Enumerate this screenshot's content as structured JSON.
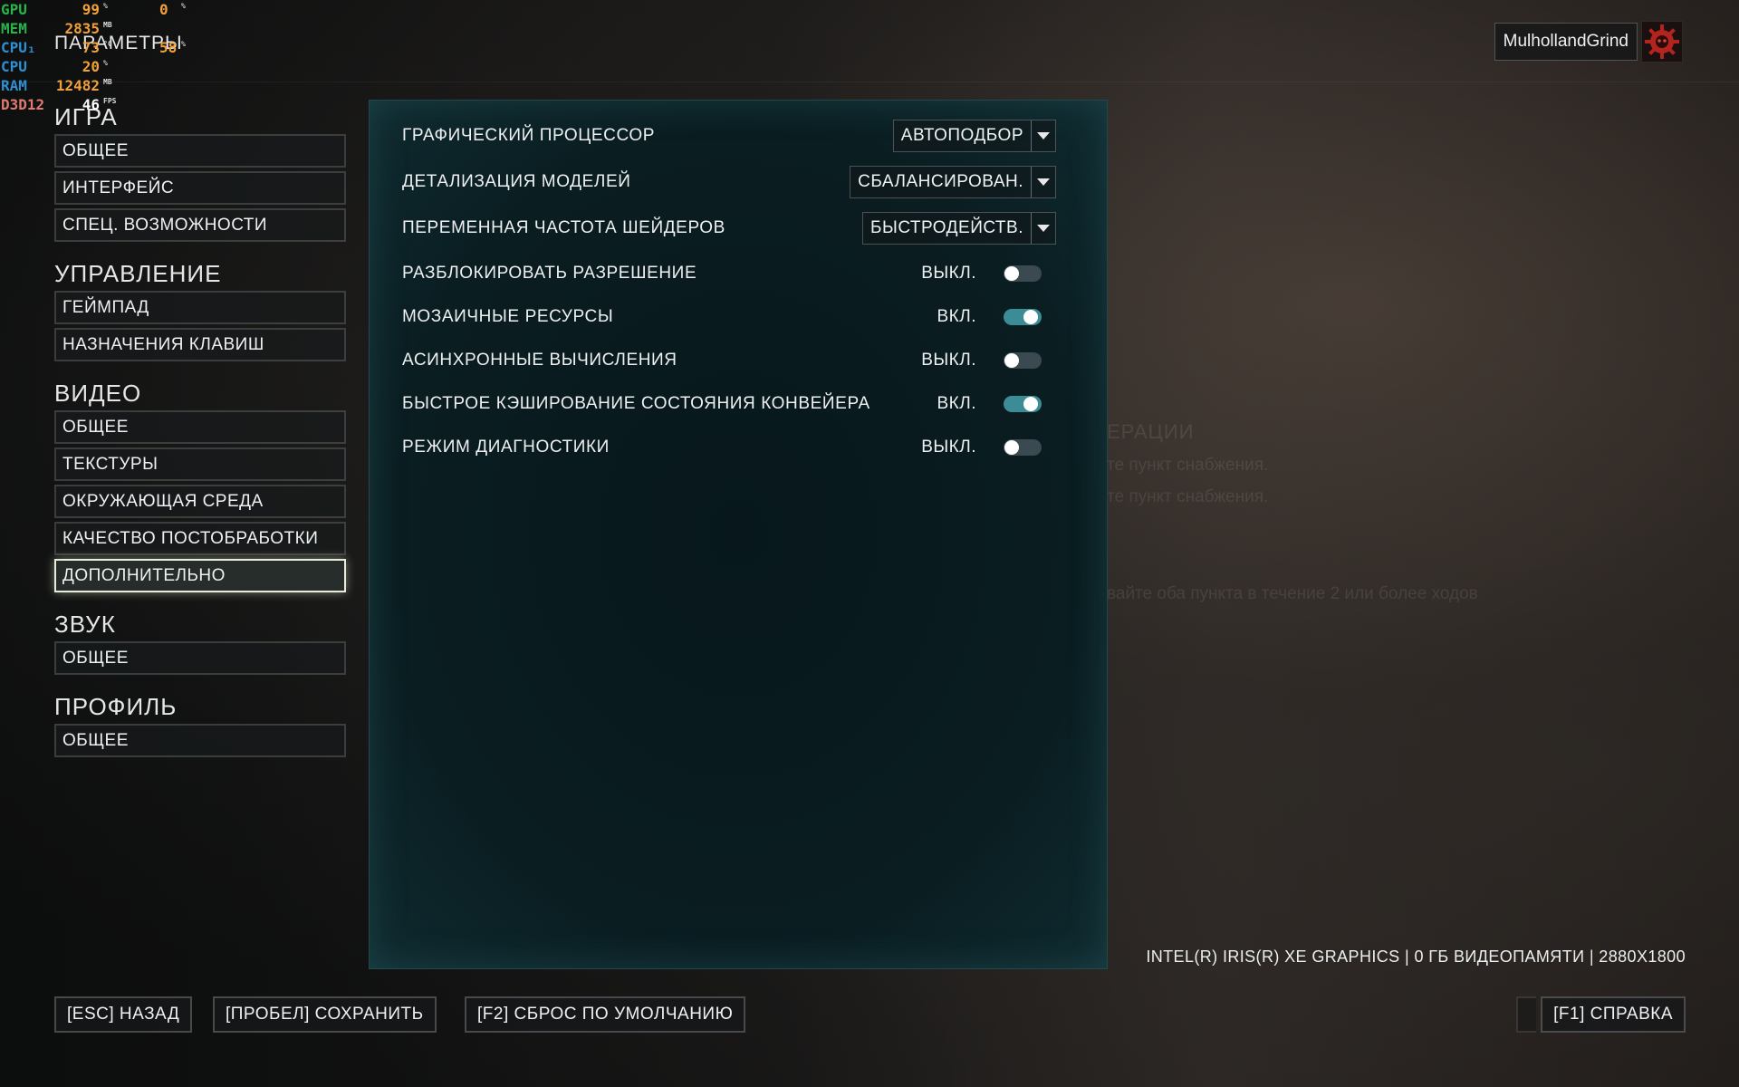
{
  "perf_overlay": {
    "rows": [
      {
        "label": "GPU",
        "value": "99",
        "unit": "%",
        "value2": "0",
        "unit2": "%",
        "color": "#29b34a"
      },
      {
        "label": "MEM",
        "value": "2835",
        "unit": "MB",
        "value2": "",
        "unit2": "",
        "color": "#29b34a"
      },
      {
        "label": "CPU₁",
        "value": "73",
        "unit": "°C",
        "value2": "58",
        "unit2": "%",
        "color": "#2f8fd0"
      },
      {
        "label": "CPU",
        "value": "20",
        "unit": "%",
        "value2": "",
        "unit2": "",
        "color": "#2f8fd0"
      },
      {
        "label": "RAM",
        "value": "12482",
        "unit": "MB",
        "value2": "",
        "unit2": "",
        "color": "#2f8fd0"
      },
      {
        "label": "D3D12",
        "value": "46",
        "unit": "FPS",
        "value2": "",
        "unit2": "",
        "color": "#e07a70"
      }
    ]
  },
  "header": {
    "title": "ПАРАМЕТРЫ",
    "username": "MulhollandGrind"
  },
  "nav": {
    "sections": [
      {
        "heading": "ИГРА",
        "items": [
          {
            "label": "ОБЩЕЕ",
            "active": false
          },
          {
            "label": "ИНТЕРФЕЙС",
            "active": false
          },
          {
            "label": "СПЕЦ. ВОЗМОЖНОСТИ",
            "active": false
          }
        ]
      },
      {
        "heading": "УПРАВЛЕНИЕ",
        "items": [
          {
            "label": "ГЕЙМПАД",
            "active": false
          },
          {
            "label": "НАЗНАЧЕНИЯ КЛАВИШ",
            "active": false
          }
        ]
      },
      {
        "heading": "ВИДЕО",
        "items": [
          {
            "label": "ОБЩЕЕ",
            "active": false
          },
          {
            "label": "ТЕКСТУРЫ",
            "active": false
          },
          {
            "label": "ОКРУЖАЮЩАЯ СРЕДА",
            "active": false
          },
          {
            "label": "КАЧЕСТВО ПОСТОБРАБОТКИ",
            "active": false
          },
          {
            "label": "ДОПОЛНИТЕЛЬНО",
            "active": true
          }
        ]
      },
      {
        "heading": "ЗВУК",
        "items": [
          {
            "label": "ОБЩЕЕ",
            "active": false
          }
        ]
      },
      {
        "heading": "ПРОФИЛЬ",
        "items": [
          {
            "label": "ОБЩЕЕ",
            "active": false
          }
        ]
      }
    ]
  },
  "settings": {
    "dropdowns": [
      {
        "label": "ГРАФИЧЕСКИЙ ПРОЦЕССОР",
        "value": "АВТОПОДБОР"
      },
      {
        "label": "ДЕТАЛИЗАЦИЯ МОДЕЛЕЙ",
        "value": "СБАЛАНСИРОВАН."
      },
      {
        "label": "ПЕРЕМЕННАЯ ЧАСТОТА ШЕЙДЕРОВ",
        "value": "БЫСТРОДЕЙСТВ."
      }
    ],
    "toggles": [
      {
        "label": "РАЗБЛОКИРОВАТЬ РАЗРЕШЕНИЕ",
        "state": "ВЫКЛ.",
        "on": false
      },
      {
        "label": "МОЗАИЧНЫЕ РЕСУРСЫ",
        "state": "ВКЛ.",
        "on": true
      },
      {
        "label": "АСИНХРОННЫЕ ВЫЧИСЛЕНИЯ",
        "state": "ВЫКЛ.",
        "on": false
      },
      {
        "label": "БЫСТРОЕ КЭШИРОВАНИЕ СОСТОЯНИЯ КОНВЕЙЕРА",
        "state": "ВКЛ.",
        "on": true
      },
      {
        "label": "РЕЖИМ ДИАГНОСТИКИ",
        "state": "ВЫКЛ.",
        "on": false
      }
    ]
  },
  "gpu_info": "INTEL(R) IRIS(R) XE GRAPHICS | 0 ГБ ВИДЕОПАМЯТИ | 2880X1800",
  "footer": {
    "back": "[ESC] НАЗАД",
    "save": "[ПРОБЕЛ] СОХРАНИТЬ",
    "reset": "[F2] СБРОС ПО УМОЛЧАНИЮ",
    "help": "[F1] СПРАВКА"
  },
  "background_text": {
    "ops": "ЕРАЦИИ",
    "supply1": "те пункт снабжения.",
    "supply2": "те пункт снабжения.",
    "hold": "вайте оба пункта в течение 2 или более ходов"
  },
  "colors": {
    "panel_border": "#22484c",
    "toggle_on": "#3b8c96",
    "toggle_off": "#3a4a50",
    "perf_value": "#f2a13a"
  }
}
